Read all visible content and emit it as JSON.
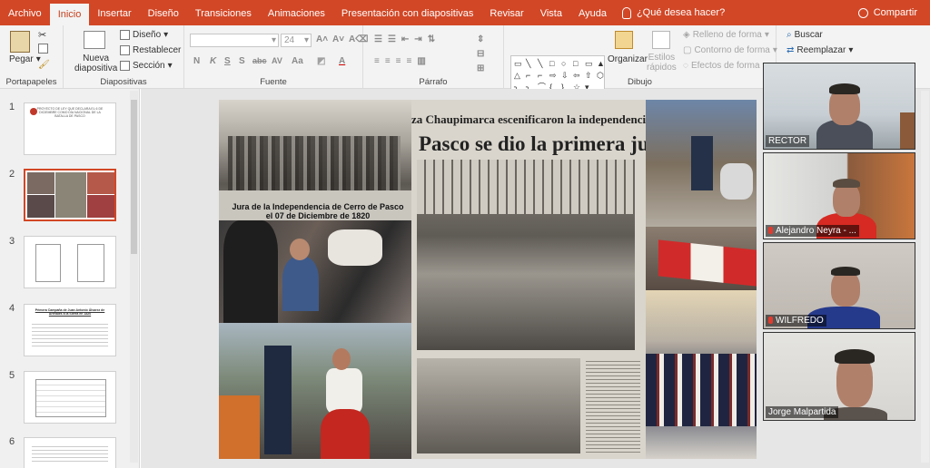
{
  "tabs": [
    "Archivo",
    "Inicio",
    "Insertar",
    "Diseño",
    "Transiciones",
    "Animaciones",
    "Presentación con diapositivas",
    "Revisar",
    "Vista",
    "Ayuda"
  ],
  "tell_me": "¿Qué desea hacer?",
  "share": "Compartir",
  "ribbon": {
    "clipboard": {
      "paste": "Pegar",
      "label": "Portapapeles"
    },
    "slides": {
      "new_slide_line1": "Nueva",
      "new_slide_line2": "diapositiva",
      "layout": "Diseño",
      "reset": "Restablecer",
      "section": "Sección",
      "label": "Diapositivas"
    },
    "font": {
      "font_size": "24",
      "label": "Fuente",
      "bold": "N",
      "italic": "K",
      "underline": "S",
      "shadow": "S",
      "strike": "abc",
      "spacing": "AV",
      "case": "Aa"
    },
    "paragraph": {
      "label": "Párrafo"
    },
    "drawing": {
      "arrange": "Organizar",
      "quick_styles_line1": "Estilos",
      "quick_styles_line2": "rápidos",
      "fill": "Relleno de forma",
      "outline": "Contorno de forma",
      "effects": "Efectos de forma",
      "label": "Dibujo"
    },
    "editing": {
      "find": "Buscar",
      "replace": "Reemplazar"
    }
  },
  "slides": [
    {
      "number": "1",
      "text": "PROYECTO DE LEY QUE DECLARA EL 6 DE DICIEMBRE COMO DÍA NACIONAL DE LA BATALLA DE PASCO"
    },
    {
      "number": "2",
      "text": ""
    },
    {
      "number": "3",
      "text": ""
    },
    {
      "number": "4",
      "text": "Primera Campaña de Juan Antonio Álvarez de Arenales a la Sierra en 1820"
    },
    {
      "number": "5",
      "text": ""
    },
    {
      "number": "6",
      "text": ""
    }
  ],
  "collage": {
    "caption1_line1": "Jura  de la Independencia de Cerro de Pasco",
    "caption1_line2": "el 07 de Diciembre de 1820",
    "headline1": "za Chaupimarca escenificaron la independencia naci",
    "headline2": "Pasco se dio la primera ju"
  },
  "participants": [
    "RECTOR",
    "Alejandro Neyra - ...",
    "WILFREDO",
    "Jorge Malpartida"
  ],
  "colors": {
    "accent": "#d24726",
    "ribbon": "#f3f3f3",
    "mic": "#e03b2f"
  }
}
